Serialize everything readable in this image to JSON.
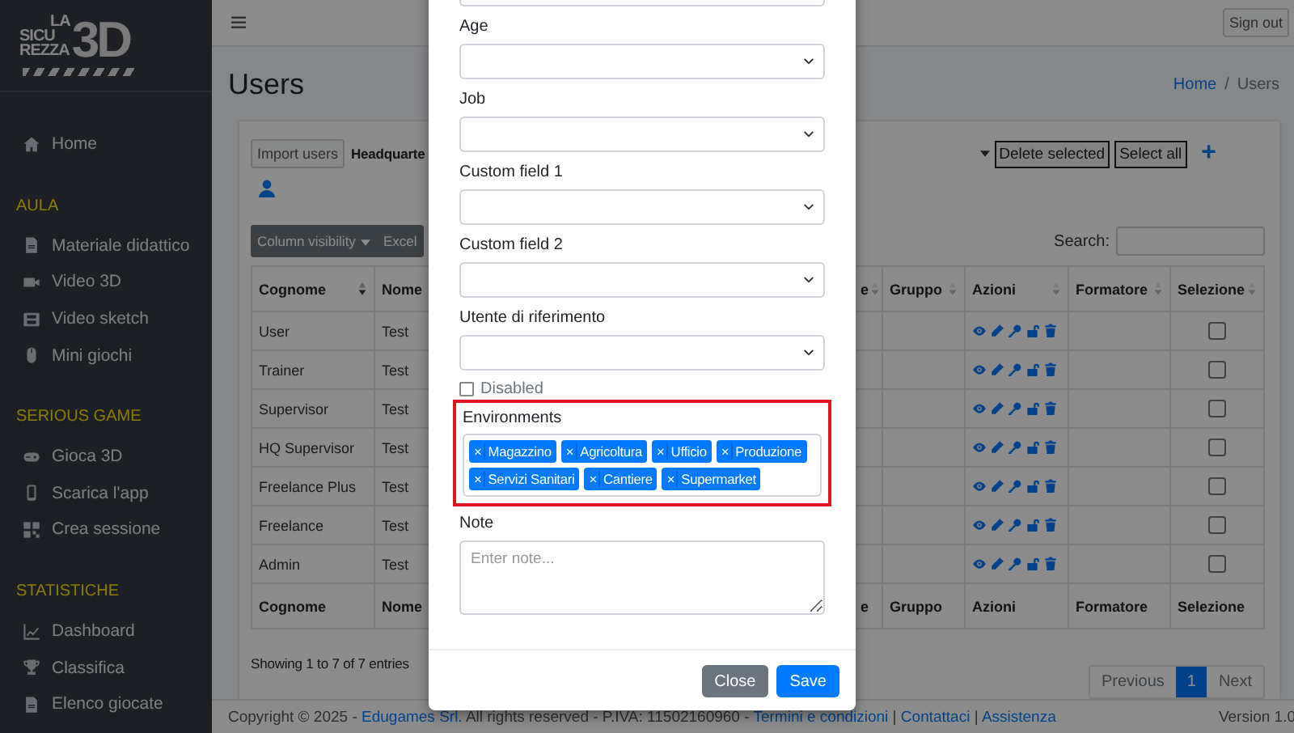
{
  "logo": {
    "lines": [
      "LA",
      "SICU",
      "REZZA"
    ],
    "mark": "3D"
  },
  "sidebar": {
    "sections": [
      {
        "items": [
          {
            "label": "Home"
          }
        ]
      },
      {
        "title": "AULA",
        "items": [
          {
            "label": "Materiale didattico"
          },
          {
            "label": "Video 3D"
          },
          {
            "label": "Video sketch"
          },
          {
            "label": "Mini giochi"
          }
        ]
      },
      {
        "title": "SERIOUS GAME",
        "items": [
          {
            "label": "Gioca 3D"
          },
          {
            "label": "Scarica l'app"
          },
          {
            "label": "Crea sessione"
          }
        ]
      },
      {
        "title": "STATISTICHE",
        "items": [
          {
            "label": "Dashboard"
          },
          {
            "label": "Classifica"
          },
          {
            "label": "Elenco giocate"
          }
        ]
      }
    ]
  },
  "header": {
    "sign_out": "Sign out"
  },
  "page": {
    "title": "Users",
    "breadcrumb_separator": "/",
    "breadcrumb": [
      {
        "label": "Home",
        "selected": false
      },
      {
        "label": "Users",
        "selected": true
      }
    ]
  },
  "toolbar": {
    "import_button": "Import users",
    "headquarter": "Headquarte",
    "delete_button": "Delete selected",
    "select_all_button": "Select all",
    "add": "+"
  },
  "table_tools": {
    "buttons": [
      "Column visibility",
      "Excel"
    ],
    "search_label": "Search:"
  },
  "table": {
    "columns": [
      {
        "label": "Cognome",
        "sorted": true
      },
      {
        "label": "Nome"
      },
      {
        "label": "e",
        "sorted": false
      },
      {
        "label": "Gruppo",
        "sorted": false
      },
      {
        "label": "Azioni",
        "sorted": false
      },
      {
        "label": "Formatore",
        "sorted": false
      },
      {
        "label": "Selezione",
        "sorted": false
      }
    ],
    "rows": [
      {
        "cognome": "User",
        "nome": "Test",
        "checked": false
      },
      {
        "cognome": "Trainer",
        "nome": "Test",
        "checked": false
      },
      {
        "cognome": "Supervisor",
        "nome": "Test",
        "checked": false
      },
      {
        "cognome": "HQ Supervisor",
        "nome": "Test",
        "checked": false
      },
      {
        "cognome": "Freelance Plus",
        "nome": "Test",
        "checked": false
      },
      {
        "cognome": "Freelance",
        "nome": "Test",
        "checked": false
      },
      {
        "cognome": "Admin",
        "nome": "Test",
        "checked": false
      }
    ],
    "footer": [
      "Cognome",
      "Nome",
      "e",
      "Gruppo",
      "Azioni",
      "Formatore",
      "Selezione"
    ]
  },
  "info": "Showing 1 to 7 of 7 entries",
  "pagination": [
    {
      "label": "Previous",
      "selected": false
    },
    {
      "label": "1",
      "selected": true
    },
    {
      "label": "Next",
      "selected": false
    }
  ],
  "footer": {
    "copyright": "Copyright © 2025 - ",
    "company": "Edugames Srl.",
    "rights": " All rights reserved - P.IVA: 11502160960 - ",
    "links": [
      "Termini e condizioni",
      "Contattaci",
      "Assistenza"
    ],
    "link_separator": "|",
    "version": "Version 1.0"
  },
  "modal": {
    "fields": [
      {
        "kind": "input"
      },
      {
        "kind": "select",
        "label": "Age"
      },
      {
        "kind": "select",
        "label": "Job"
      },
      {
        "kind": "select",
        "label": "Custom field 1"
      },
      {
        "kind": "select",
        "label": "Custom field 2"
      },
      {
        "kind": "select",
        "label": "Utente di riferimento"
      },
      {
        "kind": "checkbox",
        "label": "Disabled",
        "checked": false
      },
      {
        "kind": "tags",
        "label": "Environments",
        "highlighted": true,
        "tags": [
          {
            "remove": "×",
            "label": "Magazzino"
          },
          {
            "remove": "×",
            "label": "Agricoltura"
          },
          {
            "remove": "×",
            "label": "Ufficio"
          },
          {
            "remove": "×",
            "label": "Produzione"
          },
          {
            "remove": "×",
            "label": "Servizi Sanitari"
          },
          {
            "remove": "×",
            "label": "Cantiere"
          },
          {
            "remove": "×",
            "label": "Supermarket"
          }
        ]
      },
      {
        "kind": "textarea",
        "label": "Note",
        "placeholder": "Enter note..."
      }
    ],
    "buttons": [
      {
        "kind": "secondary",
        "label": "Close"
      },
      {
        "kind": "primary",
        "label": "Save"
      }
    ]
  }
}
